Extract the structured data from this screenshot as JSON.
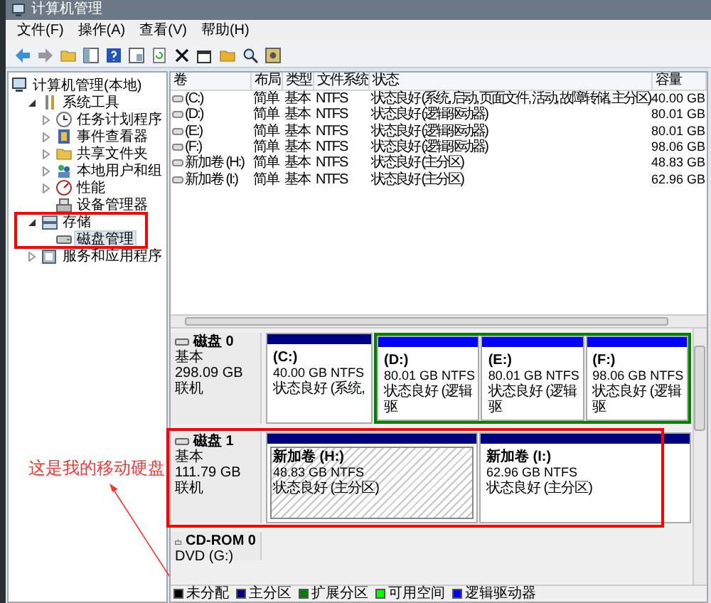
{
  "window": {
    "title": "计算机管理"
  },
  "menu": [
    "文件(F)",
    "操作(A)",
    "查看(V)",
    "帮助(H)"
  ],
  "tree": [
    {
      "label": "计算机管理(本地)",
      "selected": false,
      "children": [
        {
          "label": "系统工具",
          "expanded": true,
          "selected": false,
          "highlighted": false,
          "children": [
            {
              "label": "任务计划程序",
              "expanded": false,
              "selected": false
            },
            {
              "label": "事件查看器",
              "expanded": false,
              "selected": false
            },
            {
              "label": "共享文件夹",
              "expanded": false,
              "selected": false
            },
            {
              "label": "本地用户和组",
              "expanded": false,
              "selected": false
            },
            {
              "label": "性能",
              "expanded": false,
              "selected": false
            },
            {
              "label": "设备管理器",
              "selected": false
            }
          ]
        },
        {
          "label": "存储",
          "expanded": true,
          "selected": false,
          "highlighted": true,
          "children": [
            {
              "label": "磁盘管理",
              "selected": true
            }
          ]
        },
        {
          "label": "服务和应用程序",
          "expanded": false,
          "selected": false,
          "highlighted": false
        }
      ]
    }
  ],
  "table": {
    "columns": [
      "卷",
      "布局",
      "类型",
      "文件系统",
      "状态",
      "容量"
    ],
    "rows": [
      [
        "(C:)",
        "简单",
        "基本",
        "NTFS",
        "状态良好 (系统, 启动, 页面文件, 活动, 故障转储, 主分区)",
        "40.00 GB"
      ],
      [
        "(D:)",
        "简单",
        "基本",
        "NTFS",
        "状态良好 (逻辑驱动器)",
        "80.01 GB"
      ],
      [
        "(E:)",
        "简单",
        "基本",
        "NTFS",
        "状态良好 (逻辑驱动器)",
        "80.01 GB"
      ],
      [
        "(F:)",
        "简单",
        "基本",
        "NTFS",
        "状态良好 (逻辑驱动器)",
        "98.06 GB"
      ],
      [
        "新加卷 (H:)",
        "简单",
        "基本",
        "NTFS",
        "状态良好 (主分区)",
        "48.83 GB"
      ],
      [
        "新加卷 (I:)",
        "简单",
        "基本",
        "NTFS",
        "状态良好 (主分区)",
        "62.96 GB"
      ]
    ]
  },
  "disks": [
    {
      "kind": "disk",
      "name": "磁盘 0",
      "type": "基本",
      "size": "298.09 GB",
      "status": "联机",
      "highlighted": false,
      "partitions": [
        {
          "kind": "partition",
          "name": "(C:)",
          "size": "40.00 GB NTFS",
          "status": "状态良好 (系统,",
          "color": "#00007f",
          "selected": false
        },
        {
          "kind": "extended",
          "children": [
            {
              "kind": "partition",
              "name": "(D:)",
              "size": "80.01 GB NTFS",
              "status": "状态良好 (逻辑驱",
              "color": "#0000ff",
              "selected": false
            },
            {
              "kind": "partition",
              "name": "(E:)",
              "size": "80.01 GB NTFS",
              "status": "状态良好 (逻辑驱",
              "color": "#0000ff",
              "selected": false
            },
            {
              "kind": "partition",
              "name": "(F:)",
              "size": "98.06 GB NTFS",
              "status": "状态良好 (逻辑驱",
              "color": "#0000ff",
              "selected": false
            }
          ]
        }
      ]
    },
    {
      "kind": "disk",
      "name": "磁盘 1",
      "type": "基本",
      "size": "111.79 GB",
      "status": "联机",
      "highlighted": true,
      "partitions": [
        {
          "kind": "partition",
          "name": "新加卷  (H:)",
          "size": "48.83 GB NTFS",
          "status": "状态良好 (主分区)",
          "color": "#00007f",
          "selected": true
        },
        {
          "kind": "partition",
          "name": "新加卷  (I:)",
          "size": "62.96 GB NTFS",
          "status": "状态良好 (主分区)",
          "color": "#00007f",
          "selected": false
        }
      ]
    },
    {
      "kind": "cdrom",
      "name": "CD-ROM 0",
      "type": "DVD (G:)",
      "highlighted": false
    }
  ],
  "legend": [
    {
      "label": "未分配",
      "color": "#000000"
    },
    {
      "label": "主分区",
      "color": "#00007f"
    },
    {
      "label": "扩展分区",
      "color": "#008000"
    },
    {
      "label": "可用空间",
      "color": "#00ff00"
    },
    {
      "label": "逻辑驱动器",
      "color": "#0000ff"
    }
  ],
  "annotation": {
    "text": "这是我的移动硬盘"
  }
}
